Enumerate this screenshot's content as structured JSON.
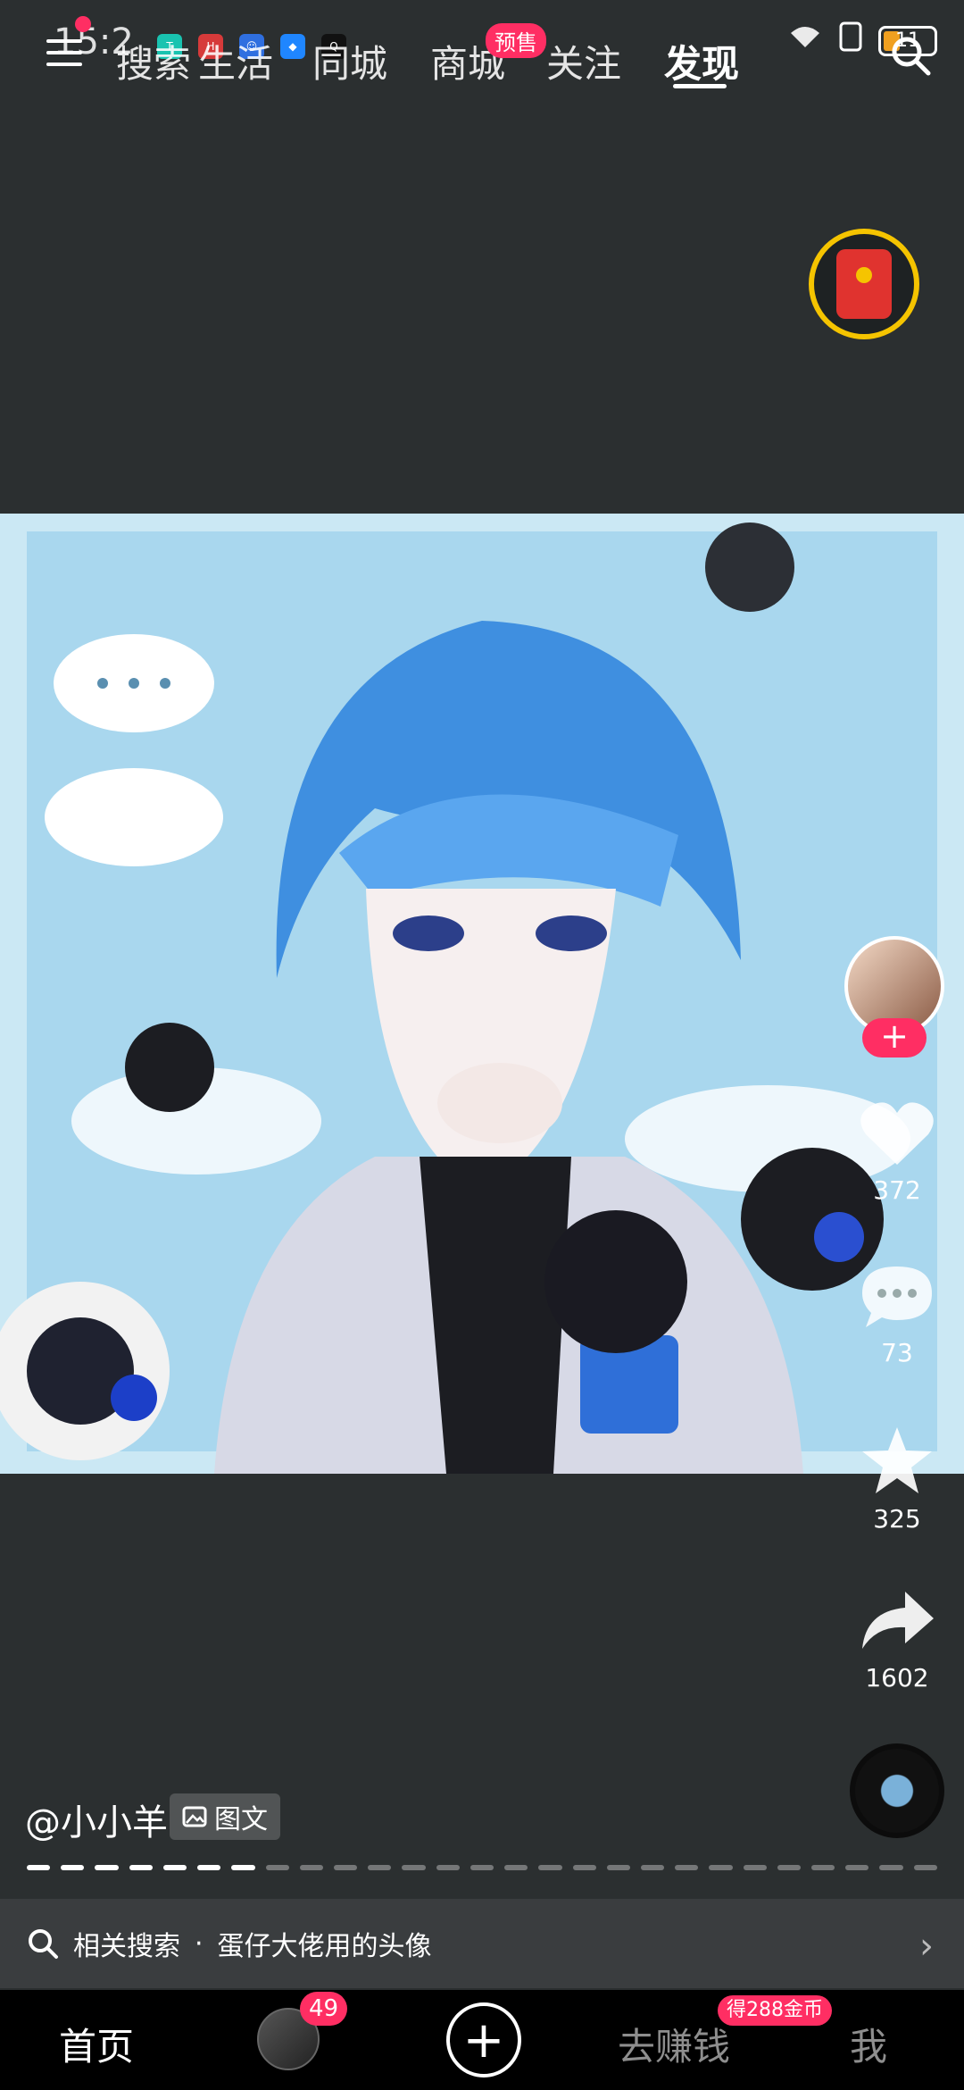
{
  "status_bar": {
    "time": "15:2",
    "battery": "11"
  },
  "top_nav": {
    "tabs": [
      "搜索",
      "生活",
      "同城",
      "商城",
      "关注",
      "发现"
    ],
    "active_tab": "发现",
    "presale_badge": "预售"
  },
  "post": {
    "author": "@小小羊",
    "type_tag": "图文",
    "progress_total": 27,
    "progress_done": 7
  },
  "actions": {
    "like_count": "372",
    "comment_count": "73",
    "favorite_count": "325",
    "share_count": "1602",
    "follow_symbol": "+"
  },
  "related_search": {
    "prefix": "相关搜索",
    "separator": "·",
    "query": "蛋仔大佬用的头像"
  },
  "bottom_nav": {
    "home": "首页",
    "messages_badge": "49",
    "plus": "+",
    "earn": "去赚钱",
    "earn_badge": "得288金币",
    "me": "我"
  },
  "icons": {
    "menu": "menu-icon",
    "search": "search-icon",
    "red_packet": "red-envelope-icon",
    "like": "heart-icon",
    "comment": "comment-icon",
    "favorite": "star-icon",
    "share": "share-icon",
    "music": "music-disc-icon"
  },
  "colors": {
    "background": "#2b2f30",
    "accent": "#ff2e63",
    "gold": "#f5c400"
  }
}
